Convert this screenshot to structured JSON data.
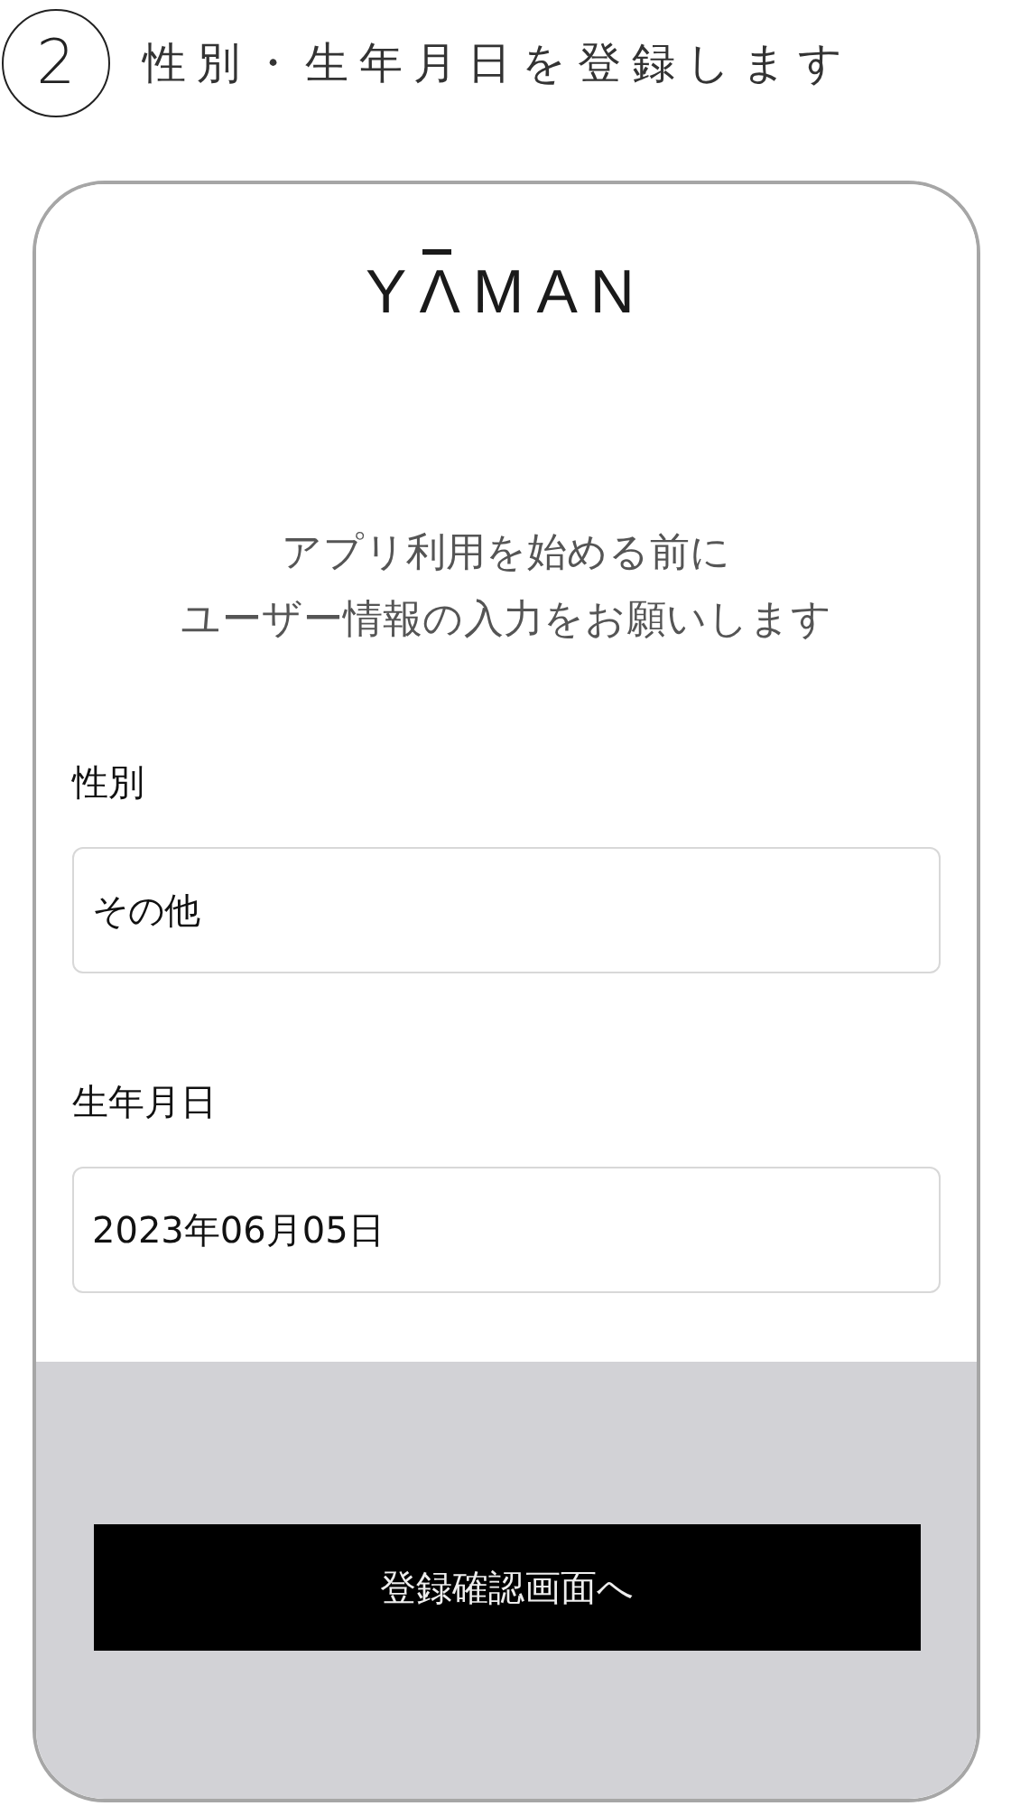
{
  "step": {
    "number": "2",
    "title": "性別・生年月日を登録します"
  },
  "app": {
    "logo": "YΛMAN",
    "intro": [
      "アプリ利用を始める前に",
      "ユーザー情報の入力をお願いします"
    ],
    "fields": [
      {
        "label": "性別",
        "value": "その他"
      },
      {
        "label": "生年月日",
        "value": "2023年06月05日"
      }
    ],
    "button": "登録確認画面へ"
  }
}
